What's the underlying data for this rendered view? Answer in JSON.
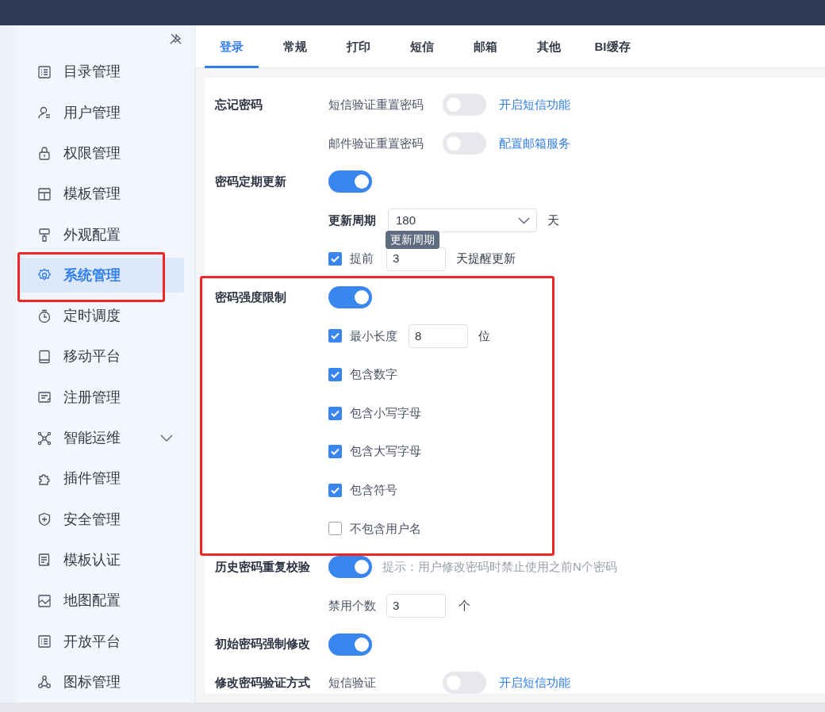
{
  "tabs": [
    {
      "label": "登录",
      "selected": true
    },
    {
      "label": "常规",
      "selected": false
    },
    {
      "label": "打印",
      "selected": false
    },
    {
      "label": "短信",
      "selected": false
    },
    {
      "label": "邮箱",
      "selected": false
    },
    {
      "label": "其他",
      "selected": false
    },
    {
      "label": "BI缓存",
      "selected": false
    }
  ],
  "sidebar": {
    "items": [
      {
        "label": "目录管理",
        "selected": false,
        "highlighted": false
      },
      {
        "label": "用户管理",
        "selected": false,
        "highlighted": false
      },
      {
        "label": "权限管理",
        "selected": false,
        "highlighted": false
      },
      {
        "label": "模板管理",
        "selected": false,
        "highlighted": false
      },
      {
        "label": "外观配置",
        "selected": false,
        "highlighted": false
      },
      {
        "label": "系统管理",
        "selected": true,
        "highlighted": true
      },
      {
        "label": "定时调度",
        "selected": false,
        "highlighted": false
      },
      {
        "label": "移动平台",
        "selected": false,
        "highlighted": false
      },
      {
        "label": "注册管理",
        "selected": false,
        "highlighted": false
      },
      {
        "label": "智能运维",
        "selected": false,
        "highlighted": false,
        "expanded": false
      },
      {
        "label": "插件管理",
        "selected": false,
        "highlighted": false
      },
      {
        "label": "安全管理",
        "selected": false,
        "highlighted": false
      },
      {
        "label": "模板认证",
        "selected": false,
        "highlighted": false
      },
      {
        "label": "地图配置",
        "selected": false,
        "highlighted": false
      },
      {
        "label": "开放平台",
        "selected": false,
        "highlighted": false
      },
      {
        "label": "图标管理",
        "selected": false,
        "highlighted": false
      }
    ]
  },
  "settings": [
    {
      "kind": "toggle",
      "label": "忘记密码",
      "option": "短信验证重置密码",
      "on": false,
      "link": "开启短信功能"
    },
    {
      "kind": "toggle",
      "option": "邮件验证重置密码",
      "on": false,
      "link": "配置邮箱服务"
    },
    {
      "kind": "toggle",
      "label": "密码定期更新",
      "on": true
    },
    {
      "kind": "select",
      "label": "更新周期",
      "value": "180",
      "unit": "天",
      "tooltip": "更新周期"
    },
    {
      "kind": "check-input",
      "label": "提前",
      "checked": true,
      "value": "3",
      "unit": "天提醒更新"
    },
    {
      "kind": "group",
      "highlighted": true,
      "items": [
        {
          "kind": "toggle",
          "label": "密码强度限制",
          "on": true
        },
        {
          "kind": "check-input",
          "label": "最小长度",
          "checked": true,
          "value": "8",
          "unit": "位"
        },
        {
          "kind": "check",
          "label": "包含数字",
          "checked": true
        },
        {
          "kind": "check",
          "label": "包含小写字母",
          "checked": true
        },
        {
          "kind": "check",
          "label": "包含大写字母",
          "checked": true
        },
        {
          "kind": "check",
          "label": "包含符号",
          "checked": true
        },
        {
          "kind": "check",
          "label": "不包含用户名",
          "checked": false
        }
      ]
    },
    {
      "kind": "toggle",
      "label": "历史密码重复校验",
      "on": true,
      "hint": "提示：用户修改密码时禁止使用之前N个密码"
    },
    {
      "kind": "input",
      "label": "禁用个数",
      "value": "3",
      "unit": "个"
    },
    {
      "kind": "toggle",
      "label": "初始密码强制修改",
      "on": true
    },
    {
      "kind": "toggle",
      "label": "修改密码验证方式",
      "option": "短信验证",
      "on": false,
      "link": "开启短信功能"
    }
  ]
}
